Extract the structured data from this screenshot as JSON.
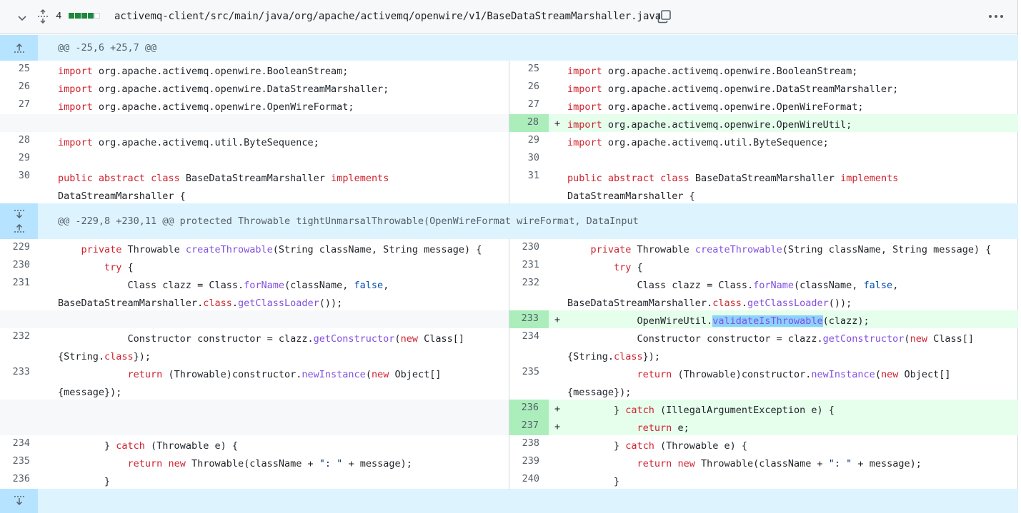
{
  "file": {
    "change_count": "4",
    "diffstat": [
      "add",
      "add",
      "add",
      "add",
      "neutral"
    ],
    "path": "activemq-client/src/main/java/org/apache/activemq/openwire/v1/BaseDataStreamMarshaller.java",
    "icons": {
      "collapse": "chevron-down-icon",
      "expand_all": "unfold-icon",
      "copy": "copy-icon",
      "menu": "kebab-horizontal-icon"
    }
  },
  "hunks": {
    "h1": "@@ -25,6 +25,7 @@",
    "h2": "@@ -229,8 +230,11 @@ protected Throwable tightUnmarsalThrowable(OpenWireFormat wireFormat, DataInput"
  },
  "lines": {
    "l1": {
      "left_num": "25",
      "right_num": "25",
      "left": "import org.apache.activemq.openwire.BooleanStream;",
      "right": "import org.apache.activemq.openwire.BooleanStream;"
    },
    "l2": {
      "left_num": "26",
      "right_num": "26",
      "left": "import org.apache.activemq.openwire.DataStreamMarshaller;",
      "right": "import org.apache.activemq.openwire.DataStreamMarshaller;"
    },
    "l3": {
      "left_num": "27",
      "right_num": "27",
      "left": "import org.apache.activemq.openwire.OpenWireFormat;",
      "right": "import org.apache.activemq.openwire.OpenWireFormat;"
    },
    "l4": {
      "right_num": "28",
      "marker": "+",
      "right": "import org.apache.activemq.openwire.OpenWireUtil;"
    },
    "l5": {
      "left_num": "28",
      "right_num": "29",
      "left": "import org.apache.activemq.util.ByteSequence;",
      "right": "import org.apache.activemq.util.ByteSequence;"
    },
    "l6": {
      "left_num": "29",
      "right_num": "30"
    },
    "l7": {
      "left_num": "30",
      "right_num": "31",
      "left_a": "public abstract class BaseDataStreamMarshaller implements",
      "left_b": "DataStreamMarshaller {",
      "right_a": "public abstract class BaseDataStreamMarshaller implements",
      "right_b": "DataStreamMarshaller {"
    },
    "m1": {
      "left_num": "229",
      "right_num": "230",
      "text": "    private Throwable createThrowable(String className, String message) {"
    },
    "m2": {
      "left_num": "230",
      "right_num": "231",
      "text": "        try {"
    },
    "m3": {
      "left_num": "231",
      "right_num": "232",
      "a": "            Class clazz = Class.forName(className, false,",
      "b": "BaseDataStreamMarshaller.class.getClassLoader());"
    },
    "m4": {
      "right_num": "233",
      "marker": "+",
      "pre": "            OpenWireUtil.",
      "hl": "validateIsThrowable",
      "post": "(clazz);"
    },
    "m5": {
      "left_num": "232",
      "right_num": "234",
      "a": "            Constructor constructor = clazz.getConstructor(new Class[]",
      "b": "{String.class});"
    },
    "m6": {
      "left_num": "233",
      "right_num": "235",
      "a": "            return (Throwable)constructor.newInstance(new Object[]",
      "b": "{message});"
    },
    "m7": {
      "right_num": "236",
      "marker": "+",
      "text": "        } catch (IllegalArgumentException e) {"
    },
    "m8": {
      "right_num": "237",
      "marker": "+",
      "text": "            return e;"
    },
    "m9": {
      "left_num": "234",
      "right_num": "238",
      "text": "        } catch (Throwable e) {"
    },
    "m10": {
      "left_num": "235",
      "right_num": "239",
      "text": "            return new Throwable(className + \": \" + message);"
    },
    "m11": {
      "left_num": "236",
      "right_num": "240",
      "text": "        }"
    }
  },
  "colors": {
    "hunk_bg": "#ddf4ff",
    "add_bg": "#e6ffec",
    "add_num_bg": "#aceebb",
    "keyword": "#cf222e",
    "function": "#8250df"
  }
}
